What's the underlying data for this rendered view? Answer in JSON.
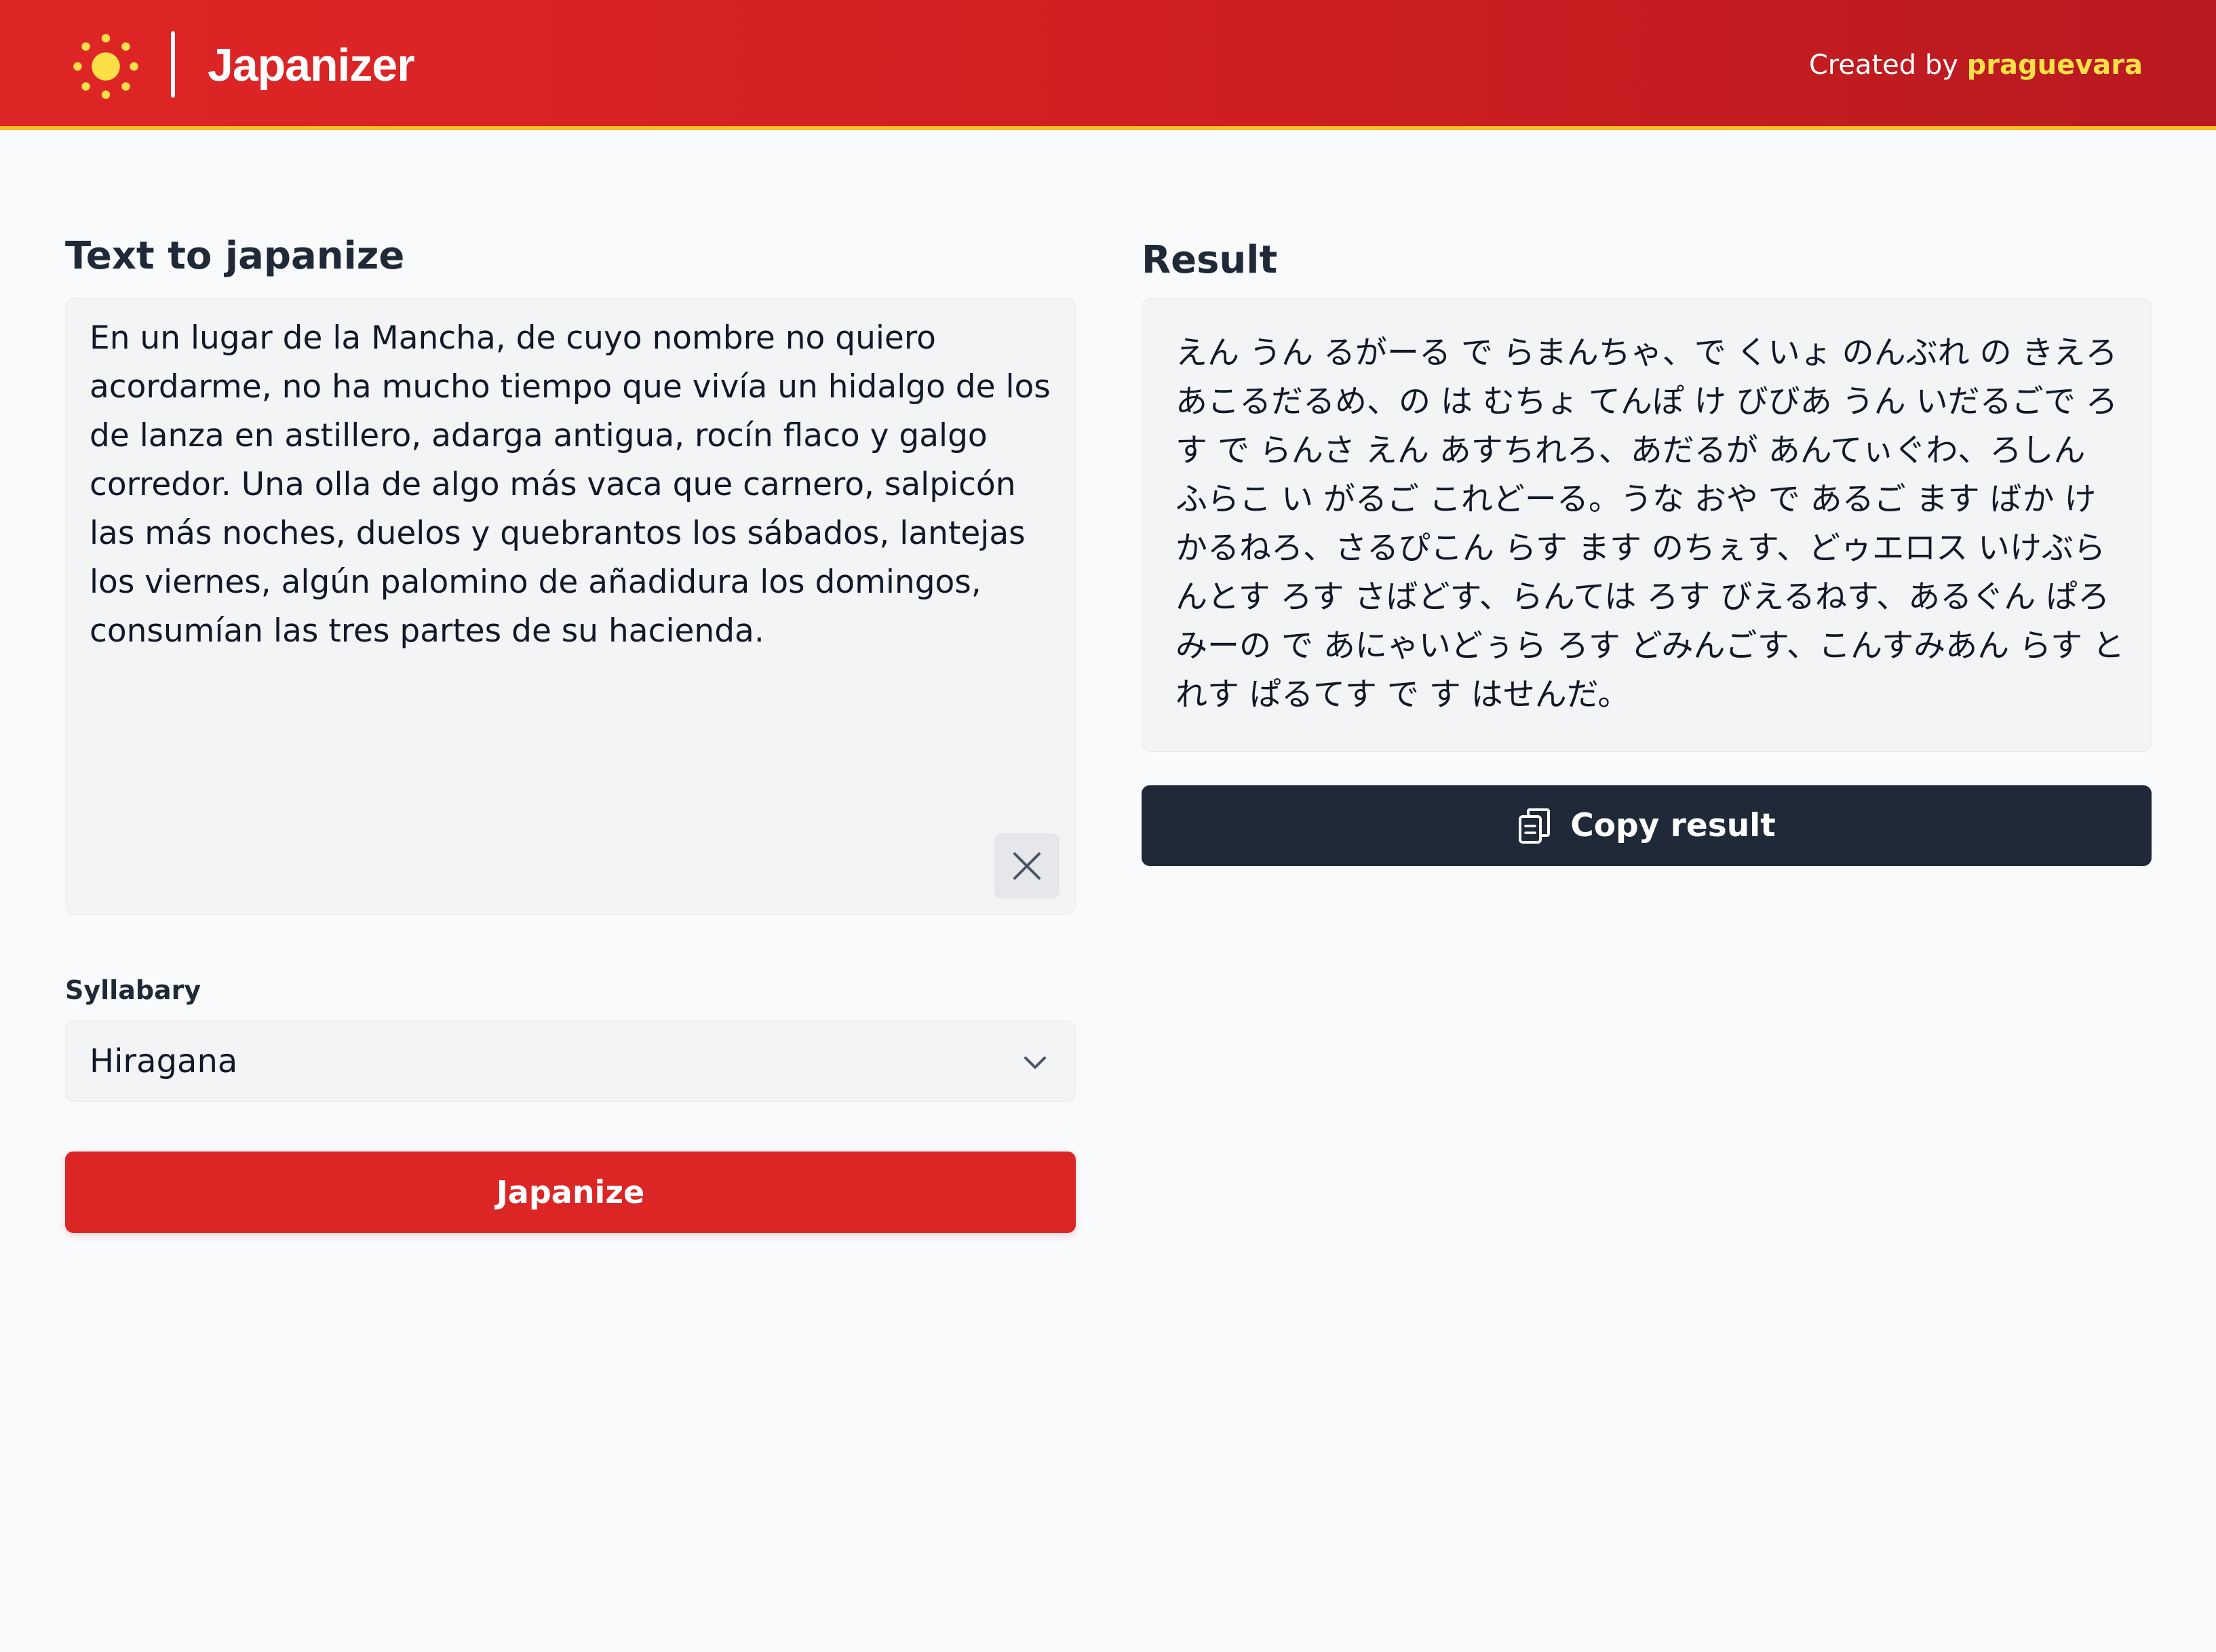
{
  "header": {
    "app_title": "Japanizer",
    "credit_prefix": "Created by",
    "credit_author": "praguevara",
    "logo_icon": "sun-icon",
    "colors": {
      "brand_red": "#dc2626",
      "accent_yellow": "#fbbf24"
    }
  },
  "input": {
    "label": "Text to japanize",
    "value": "En un lugar de la Mancha, de cuyo nombre no quiero acordarme, no ha mucho tiempo que vivía un hidalgo de los de lanza en astillero, adarga antigua, rocín flaco y galgo corredor. Una olla de algo más vaca que carnero, salpicón las más noches, duelos y quebrantos los sábados, lantejas los viernes, algún palomino de añadidura los domingos, consumían las tres partes de su hacienda.",
    "clear_icon": "close-icon"
  },
  "syllabary": {
    "label": "Syllabary",
    "selected": "Hiragana",
    "icon": "chevron-down-icon"
  },
  "actions": {
    "japanize_label": "Japanize",
    "copy_label": "Copy result",
    "copy_icon": "clipboard-copy-icon"
  },
  "result": {
    "label": "Result",
    "value": "えん うん るがーる で らまんちゃ、で くいょ のんぶれ の きえろ あこるだるめ、の は むちょ てんぽ け びびあ うん いだるごで ろす で らんさ えん あすちれろ、あだるが あんてぃぐわ、ろしん ふらこ い がるご これどーる。うな おや で あるご ます ばか け かるねろ、さるぴこん らす ます のちぇす、どゥエロス いけぶらんとす ろす さばどす、らんては ろす びえるねす、あるぐん ぱろみーの で あにゃいどぅら ろす どみんごす、こんすみあん らす とれす ぱるてす で す はせんだ。"
  }
}
